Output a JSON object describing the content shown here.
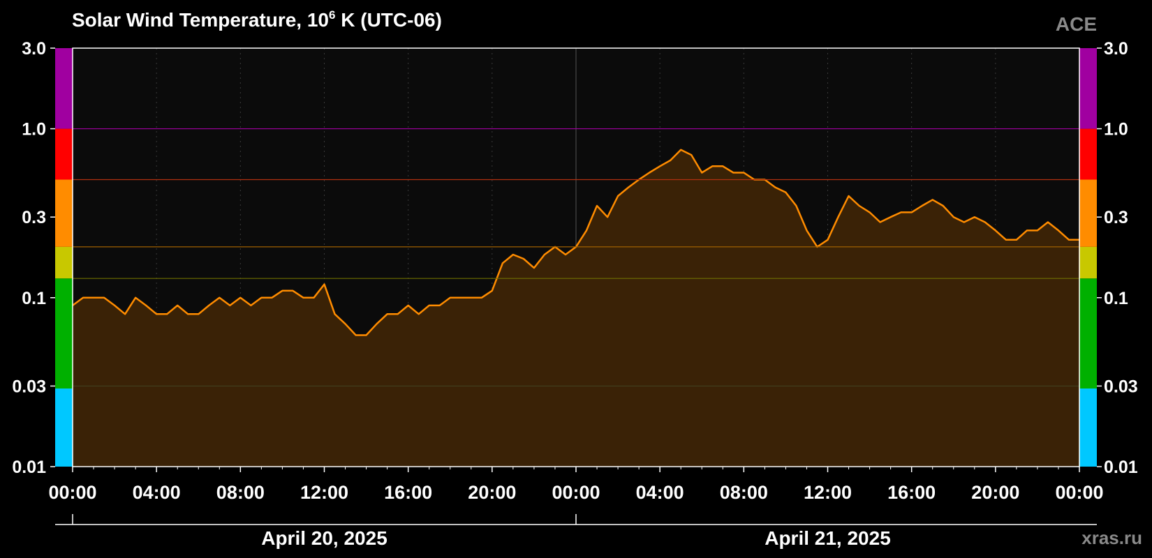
{
  "chart_data": {
    "type": "area",
    "title_main": "Solar Wind Temperature, 10",
    "title_sup": "6",
    "title_rest": " K (UTC-06)",
    "brand": "ACE",
    "watermark": "xras.ru",
    "y_scale": "log",
    "ylim": [
      0.01,
      3.0
    ],
    "y_ticks": [
      {
        "value": 0.01,
        "label": "0.01"
      },
      {
        "value": 0.03,
        "label": "0.03"
      },
      {
        "value": 0.1,
        "label": "0.1"
      },
      {
        "value": 0.3,
        "label": "0.3"
      },
      {
        "value": 1.0,
        "label": "1.0"
      },
      {
        "value": 3.0,
        "label": "3.0"
      }
    ],
    "x_unit": "hours since 2025-04-20 00:00 (UTC-06)",
    "xlim": [
      0,
      48
    ],
    "x_ticks": [
      {
        "value": 0,
        "label": "00:00"
      },
      {
        "value": 4,
        "label": "04:00"
      },
      {
        "value": 8,
        "label": "08:00"
      },
      {
        "value": 12,
        "label": "12:00"
      },
      {
        "value": 16,
        "label": "16:00"
      },
      {
        "value": 20,
        "label": "20:00"
      },
      {
        "value": 24,
        "label": "00:00"
      },
      {
        "value": 28,
        "label": "04:00"
      },
      {
        "value": 32,
        "label": "08:00"
      },
      {
        "value": 36,
        "label": "12:00"
      },
      {
        "value": 40,
        "label": "16:00"
      },
      {
        "value": 44,
        "label": "20:00"
      },
      {
        "value": 48,
        "label": "00:00"
      }
    ],
    "dates": [
      {
        "label": "April 20, 2025",
        "center": 12
      },
      {
        "label": "April 21, 2025",
        "center": 36
      }
    ],
    "thresholds": [
      {
        "value": 1.0,
        "color": "#a000a0"
      },
      {
        "value": 0.5,
        "color": "#b03010"
      },
      {
        "value": 0.2,
        "color": "#a06000"
      },
      {
        "value": 0.13,
        "color": "#707000"
      },
      {
        "value": 0.03,
        "color": "#404020"
      }
    ],
    "level_bands": [
      {
        "from": 0.01,
        "to": 0.029,
        "color": "#00c8ff"
      },
      {
        "from": 0.029,
        "to": 0.13,
        "color": "#00b000"
      },
      {
        "from": 0.13,
        "to": 0.2,
        "color": "#c8c800"
      },
      {
        "from": 0.2,
        "to": 0.5,
        "color": "#ff8c00"
      },
      {
        "from": 0.5,
        "to": 1.0,
        "color": "#ff0000"
      },
      {
        "from": 1.0,
        "to": 3.0,
        "color": "#a000a0"
      }
    ],
    "series": [
      {
        "line_color": "#ff8c00",
        "fill_color": "#3a2206",
        "x": [
          0,
          0.5,
          1,
          1.5,
          2,
          2.5,
          3,
          3.5,
          4,
          4.5,
          5,
          5.5,
          6,
          6.5,
          7,
          7.5,
          8,
          8.5,
          9,
          9.5,
          10,
          10.5,
          11,
          11.5,
          12,
          12.5,
          13,
          13.5,
          14,
          14.5,
          15,
          15.5,
          16,
          16.5,
          17,
          17.5,
          18,
          18.5,
          19,
          19.5,
          20,
          20.5,
          21,
          21.5,
          22,
          22.5,
          23,
          23.5,
          24,
          24.5,
          25,
          25.5,
          26,
          26.5,
          27,
          27.5,
          28,
          28.5,
          29,
          29.5,
          30,
          30.5,
          31,
          31.5,
          32,
          32.5,
          33,
          33.5,
          34,
          34.5,
          35,
          35.5,
          36,
          36.5,
          37,
          37.5,
          38,
          38.5,
          39,
          39.5,
          40,
          40.5,
          41,
          41.5,
          42,
          42.5,
          43,
          43.5,
          44,
          44.5,
          45,
          45.5,
          46,
          46.5,
          47,
          47.5,
          48
        ],
        "values": [
          0.09,
          0.1,
          0.1,
          0.1,
          0.09,
          0.08,
          0.1,
          0.09,
          0.08,
          0.08,
          0.09,
          0.08,
          0.08,
          0.09,
          0.1,
          0.09,
          0.1,
          0.09,
          0.1,
          0.1,
          0.11,
          0.11,
          0.1,
          0.1,
          0.12,
          0.08,
          0.07,
          0.06,
          0.06,
          0.07,
          0.08,
          0.08,
          0.09,
          0.08,
          0.09,
          0.09,
          0.1,
          0.1,
          0.1,
          0.1,
          0.11,
          0.16,
          0.18,
          0.17,
          0.15,
          0.18,
          0.2,
          0.18,
          0.2,
          0.25,
          0.35,
          0.3,
          0.4,
          0.45,
          0.5,
          0.55,
          0.6,
          0.65,
          0.75,
          0.7,
          0.55,
          0.6,
          0.6,
          0.55,
          0.55,
          0.5,
          0.5,
          0.45,
          0.42,
          0.35,
          0.25,
          0.2,
          0.22,
          0.3,
          0.4,
          0.35,
          0.32,
          0.28,
          0.3,
          0.32,
          0.32,
          0.35,
          0.38,
          0.35,
          0.3,
          0.28,
          0.3,
          0.28,
          0.25,
          0.22,
          0.22,
          0.25,
          0.25,
          0.28,
          0.25,
          0.22,
          0.22
        ]
      }
    ]
  }
}
